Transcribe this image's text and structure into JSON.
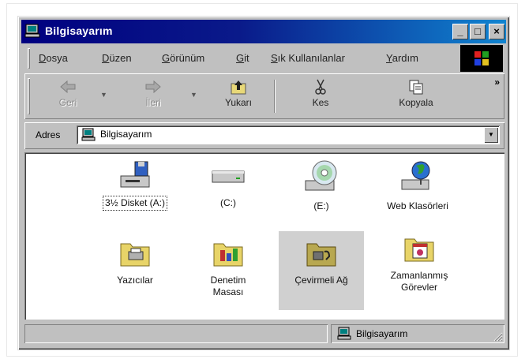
{
  "window": {
    "title": "Bilgisayarım",
    "controls": {
      "minimize": "_",
      "maximize": "□",
      "close": "×"
    }
  },
  "menu": [
    {
      "accel": "D",
      "rest": "osya"
    },
    {
      "accel": "D",
      "rest": "üzen"
    },
    {
      "accel": "G",
      "rest": "örünüm"
    },
    {
      "accel": "G",
      "rest": "it"
    },
    {
      "accel": "S",
      "rest": "ık Kullanılanlar"
    },
    {
      "accel": "Y",
      "rest": "ardım"
    }
  ],
  "toolbar": {
    "back": "Geri",
    "forward": "İleri",
    "up": "Yukarı",
    "cut": "Kes",
    "copy": "Kopyala",
    "more": "»"
  },
  "address": {
    "label": "Adres",
    "value": "Bilgisayarım"
  },
  "items": [
    {
      "label": "3½ Disket (A:)",
      "icon": "floppy-drive-icon"
    },
    {
      "label": "(C:)",
      "icon": "hard-drive-icon"
    },
    {
      "label": "(E:)",
      "icon": "cd-drive-icon"
    },
    {
      "label": "Web Klasörleri",
      "icon": "web-folders-icon"
    },
    {
      "label": "Yazıcılar",
      "icon": "printers-folder-icon"
    },
    {
      "label": "Denetim Masası",
      "icon": "control-panel-folder-icon"
    },
    {
      "label": "Çevirmeli Ağ",
      "icon": "dial-up-networking-folder-icon"
    },
    {
      "label": "Zamanlanmış Görevler",
      "icon": "scheduled-tasks-folder-icon"
    }
  ],
  "status": {
    "left": "",
    "right": "Bilgisayarım"
  },
  "colors": {
    "titlebar_start": "#000080",
    "titlebar_end": "#1084d0",
    "chrome": "#c0c0c0"
  }
}
